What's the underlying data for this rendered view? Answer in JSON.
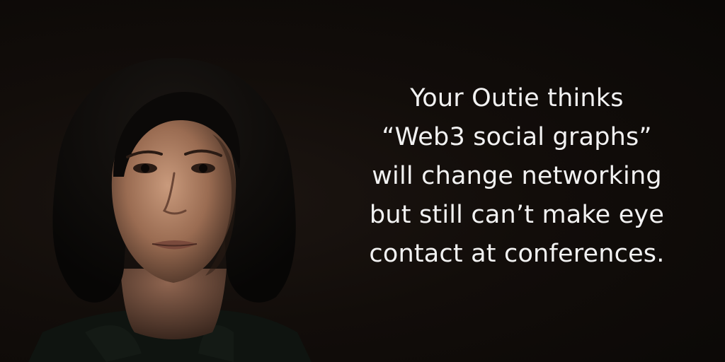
{
  "caption": {
    "lines": [
      "Your Outie thinks",
      "“Web3 social graphs”",
      "will change networking",
      "but still can’t make eye",
      "contact at conferences."
    ]
  },
  "colors": {
    "background": "#0d0a08",
    "text": "#f2f2f2",
    "hair": "#0b0908",
    "skin": "#b8876a",
    "top": "#0f1410"
  }
}
